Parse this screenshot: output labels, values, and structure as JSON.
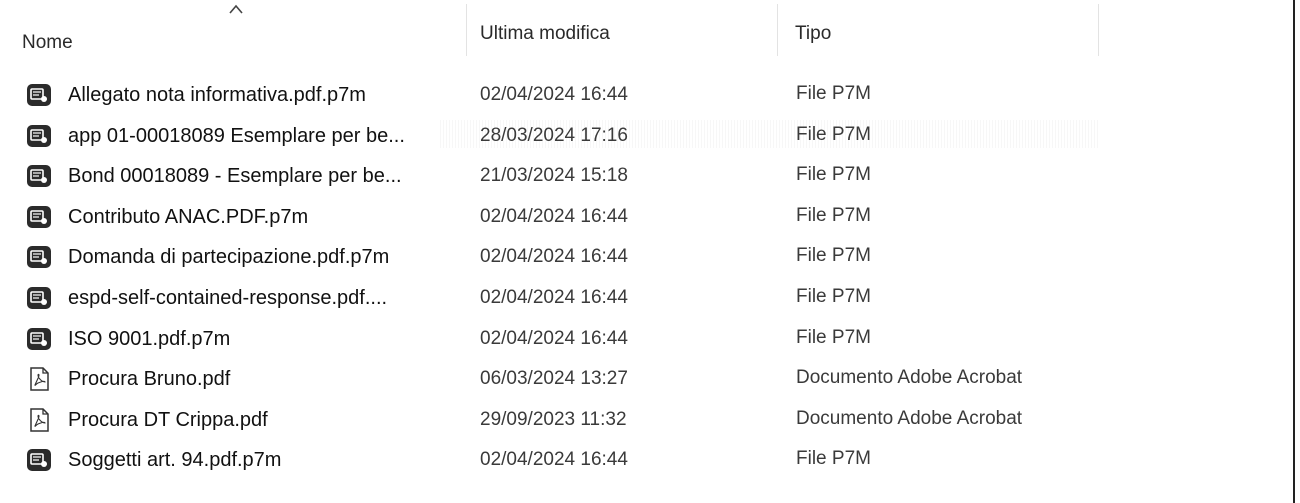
{
  "header": {
    "name_label": "Nome",
    "modified_label": "Ultima modifica",
    "type_label": "Tipo",
    "sort_direction": "ascending"
  },
  "files": [
    {
      "name": "Allegato nota informativa.pdf.p7m",
      "modified": "02/04/2024 16:44",
      "type": "File P7M",
      "icon": "p7m-file-icon"
    },
    {
      "name": "app 01-00018089 Esemplare per be...",
      "modified": "28/03/2024 17:16",
      "type": "File P7M",
      "icon": "p7m-file-icon"
    },
    {
      "name": "Bond 00018089 - Esemplare per be...",
      "modified": "21/03/2024 15:18",
      "type": "File P7M",
      "icon": "p7m-file-icon"
    },
    {
      "name": "Contributo ANAC.PDF.p7m",
      "modified": "02/04/2024 16:44",
      "type": "File P7M",
      "icon": "p7m-file-icon"
    },
    {
      "name": "Domanda di partecipazione.pdf.p7m",
      "modified": "02/04/2024 16:44",
      "type": "File P7M",
      "icon": "p7m-file-icon"
    },
    {
      "name": "espd-self-contained-response.pdf....",
      "modified": "02/04/2024 16:44",
      "type": "File P7M",
      "icon": "p7m-file-icon"
    },
    {
      "name": "ISO 9001.pdf.p7m",
      "modified": "02/04/2024 16:44",
      "type": "File P7M",
      "icon": "p7m-file-icon"
    },
    {
      "name": "Procura Bruno.pdf",
      "modified": "06/03/2024 13:27",
      "type": "Documento Adobe Acrobat",
      "icon": "pdf-file-icon"
    },
    {
      "name": "Procura DT Crippa.pdf",
      "modified": "29/09/2023 11:32",
      "type": "Documento Adobe Acrobat",
      "icon": "pdf-file-icon"
    },
    {
      "name": "Soggetti art. 94.pdf.p7m",
      "modified": "02/04/2024 16:44",
      "type": "File P7M",
      "icon": "p7m-file-icon"
    }
  ],
  "colors": {
    "p7m_icon_bg": "#2b2b2b",
    "p7m_icon_fg": "#ffffff",
    "pdf_icon_stroke": "#333333",
    "text": "#111111",
    "secondary_text": "#3a3a3a"
  }
}
